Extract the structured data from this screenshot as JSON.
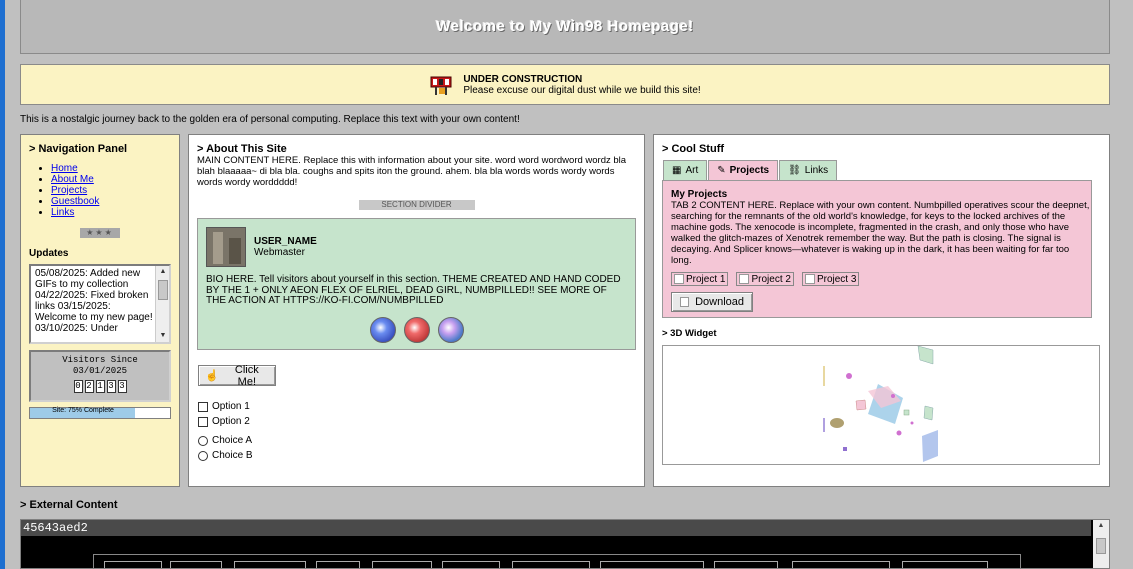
{
  "header": {
    "title": "Welcome to My Win98 Homepage!"
  },
  "construction": {
    "title": "UNDER CONSTRUCTION",
    "message": "Please excuse our digital dust while we build this site!"
  },
  "intro": "This is a nostalgic journey back to the golden era of personal computing. Replace this text with your own content!",
  "nav": {
    "title": "> Navigation Panel",
    "links": [
      "Home",
      "About Me",
      "Projects",
      "Guestbook",
      "Links"
    ],
    "stars": "★★★",
    "updates_title": "Updates",
    "updates_text": "05/08/2025: Added new GIFs to my collection 04/22/2025: Fixed broken links 03/15/2025: Welcome to my new page! 03/10/2025: Under",
    "visitors_label": "Visitors Since",
    "visitors_date": "03/01/2025",
    "counter_digits": [
      "0",
      "2",
      "1",
      "3",
      "3"
    ],
    "progress_label": "Site: 75% Complete",
    "progress_value": 0.75
  },
  "about": {
    "title": "> About This Site",
    "text": "MAIN CONTENT HERE. Replace this with information about your site. word word wordword wordz bla blah blaaaaa~ di bla bla. coughs and spits iton the ground. ahem. bla bla words words wordy words words wordy worddddd!",
    "divider": "SECTION DIVIDER",
    "user_name": "USER_NAME",
    "user_role": "Webmaster",
    "bio": "BIO HERE. Tell visitors about yourself in this section. THEME CREATED AND HAND CODED BY THE 1 + ONLY AEON FLEX OF ELRIEL, DEAD GIRL, NUMBPILLED!! SEE MORE OF THE ACTION AT HTTPS://KO-FI.COM/NUMBPILLED",
    "click_label": "Click Me!",
    "checkboxes": [
      "Option 1",
      "Option 2"
    ],
    "radios": [
      "Choice A",
      "Choice B"
    ]
  },
  "cool": {
    "title": "> Cool Stuff",
    "tabs": [
      "Art",
      "Projects",
      "Links"
    ],
    "active_tab": "Projects",
    "tab_title": "My Projects",
    "tab_text": "TAB 2 CONTENT HERE. Replace with your own content. Numbpilled operatives scour the deepnet, searching for the remnants of the old world's knowledge, for keys to the locked archives of the machine gods. The xenocode is incomplete, fragmented in the crash, and only those who have walked the glitch-mazes of Xenotrek remember the way. But the path is closing. The signal is decaying. And Splicer knows—whatever is waking up in the dark, it has been waiting for far too long.",
    "projects": [
      "Project 1",
      "Project 2",
      "Project 3"
    ],
    "download_label": "Download",
    "widget_title": "> 3D Widget"
  },
  "external": {
    "title": "> External Content",
    "bar_text": "45643aed2"
  },
  "colors": {
    "panel_yellow": "#fbf3c3",
    "tab_green": "#c6e4cc",
    "tab_pink": "#f4c6d6",
    "link_blue": "#0000ee"
  },
  "icons": {
    "construction": "construction-sign-icon",
    "art_tab": "palette-icon",
    "projects_tab": "notepad-icon",
    "links_tab": "link-chain-icon",
    "click": "hand-icon",
    "download": "broken-image-icon"
  }
}
